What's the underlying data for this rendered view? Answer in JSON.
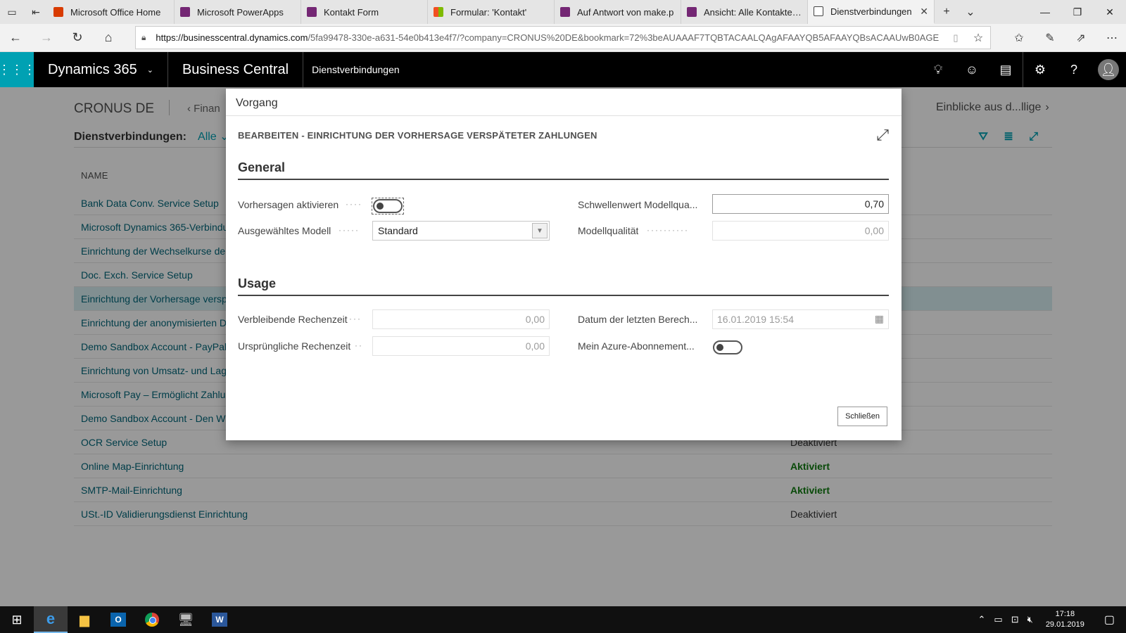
{
  "browser": {
    "tabs": [
      {
        "label": "Microsoft Office Home",
        "favicon": "office-icon"
      },
      {
        "label": "Microsoft PowerApps",
        "favicon": "powerapps-icon"
      },
      {
        "label": "Kontakt Form",
        "favicon": "powerapps-icon"
      },
      {
        "label": "Formular: 'Kontakt'",
        "favicon": "microsoft-icon"
      },
      {
        "label": "Auf Antwort von make.p",
        "favicon": "powerapps-icon"
      },
      {
        "label": "Ansicht: Alle Kontakte - I",
        "favicon": "powerapps-icon"
      },
      {
        "label": "Dienstverbindungen",
        "favicon": "page-icon",
        "active": true
      }
    ],
    "url_host": "https://businesscentral.dynamics.com",
    "url_path": "/5fa99478-330e-a631-54e0b413e4f7/?company=CRONUS%20DE&bookmark=72%3beAUAAAF7TQBTACAALQAgAFAAYQB5AFAAYQBsACAAUwB0AGE"
  },
  "appbar": {
    "product": "Dynamics 365",
    "app": "Business Central",
    "page": "Dienstverbindungen"
  },
  "page": {
    "company": "CRONUS DE",
    "nav_left": "Finan",
    "nav_partial": "n",
    "nav_right": "Einblicke aus d...llige",
    "title": "Dienstverbindungen:",
    "filter": "Alle",
    "column_name": "NAME",
    "rows": [
      {
        "name": "Bank Data Conv. Service Setup",
        "status": ""
      },
      {
        "name": "Microsoft Dynamics 365-Verbindu",
        "status": ""
      },
      {
        "name": "Einrichtung der Wechselkurse der",
        "status": ""
      },
      {
        "name": "Doc. Exch. Service Setup",
        "status": ""
      },
      {
        "name": "Einrichtung der Vorhersage versp",
        "status": "",
        "selected": true
      },
      {
        "name": "Einrichtung der anonymisierten D",
        "status": ""
      },
      {
        "name": "Demo Sandbox Account - PayPal",
        "status": ""
      },
      {
        "name": "Einrichtung von Umsatz- und Lag",
        "status": ""
      },
      {
        "name": "Microsoft Pay – Ermöglicht Zahlu",
        "status": ""
      },
      {
        "name": "Demo Sandbox Account - Den W",
        "status": ""
      },
      {
        "name": "OCR Service Setup",
        "status": "Deaktiviert"
      },
      {
        "name": "Online Map-Einrichtung",
        "status": "Aktiviert"
      },
      {
        "name": "SMTP-Mail-Einrichtung",
        "status": "Aktiviert"
      },
      {
        "name": "USt.-ID Validierungsdienst Einrichtung",
        "status": "Deaktiviert"
      }
    ]
  },
  "dialog": {
    "title": "Vorgang",
    "subtitle": "BEARBEITEN - EINRICHTUNG DER VORHERSAGE VERSPÄTETER ZAHLUNGEN",
    "general": {
      "heading": "General",
      "enable_label": "Vorhersagen aktivieren",
      "enable_value": false,
      "model_label": "Ausgewähltes Modell",
      "model_value": "Standard",
      "threshold_label": "Schwellenwert Modellqua...",
      "threshold_value": "0,70",
      "quality_label": "Modellqualität",
      "quality_value": "0,00"
    },
    "usage": {
      "heading": "Usage",
      "remaining_label": "Verbleibende Rechenzeit",
      "remaining_value": "0,00",
      "original_label": "Ursprüngliche Rechenzeit",
      "original_value": "0,00",
      "lastdate_label": "Datum der letzten Berech...",
      "lastdate_value": "16.01.2019 15:54",
      "azure_label": "Mein Azure-Abonnement...",
      "azure_value": false
    },
    "close_label": "Schließen"
  },
  "taskbar": {
    "time": "17:18",
    "date": "29.01.2019"
  },
  "colors": {
    "accent": "#00a1b3",
    "link": "#00677a",
    "enabled": "#107c10",
    "selected_row": "#d7eff2"
  }
}
